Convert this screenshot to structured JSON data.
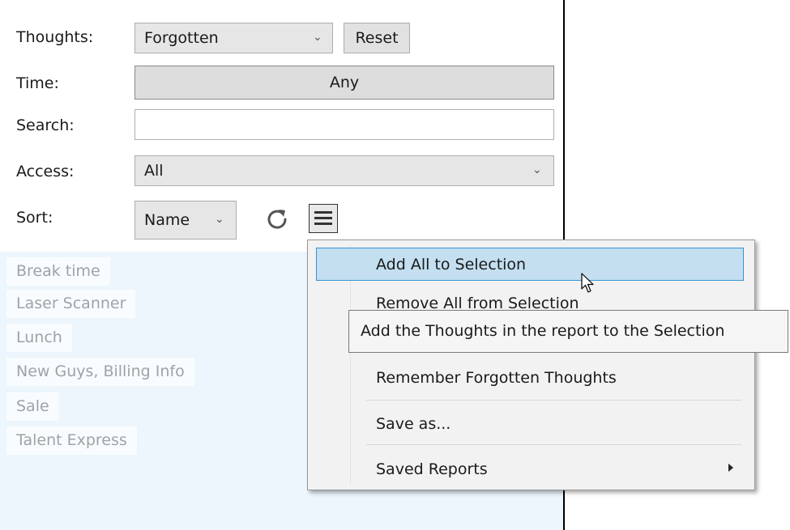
{
  "filters": {
    "thoughts_label": "Thoughts:",
    "thoughts_value": "Forgotten",
    "reset_label": "Reset",
    "time_label": "Time:",
    "time_value": "Any",
    "search_label": "Search:",
    "search_value": "",
    "access_label": "Access:",
    "access_value": "All",
    "sort_label": "Sort:",
    "sort_value": "Name"
  },
  "icons": {
    "dropdown": "chevron-down-icon",
    "refresh": "refresh-icon",
    "menu": "hamburger-menu-icon",
    "submenu": "triangle-right-icon",
    "cursor": "mouse-pointer-icon"
  },
  "results": [
    "Break time",
    "Laser Scanner",
    "Lunch",
    "New Guys, Billing Info",
    "Sale",
    "Talent Express"
  ],
  "menu": {
    "add_all": "Add All to Selection",
    "remove_all": "Remove All from Selection",
    "remember_forgotten": "Remember Forgotten Thoughts",
    "save_as": "Save as...",
    "saved_reports": "Saved Reports"
  },
  "tooltip": "Add the Thoughts in the report to the Selection",
  "colors": {
    "list_background": "#ecf6fc",
    "menu_highlight": "#c3dff0",
    "menu_highlight_border": "#3a93d3",
    "menu_background": "#f2f2f2"
  }
}
